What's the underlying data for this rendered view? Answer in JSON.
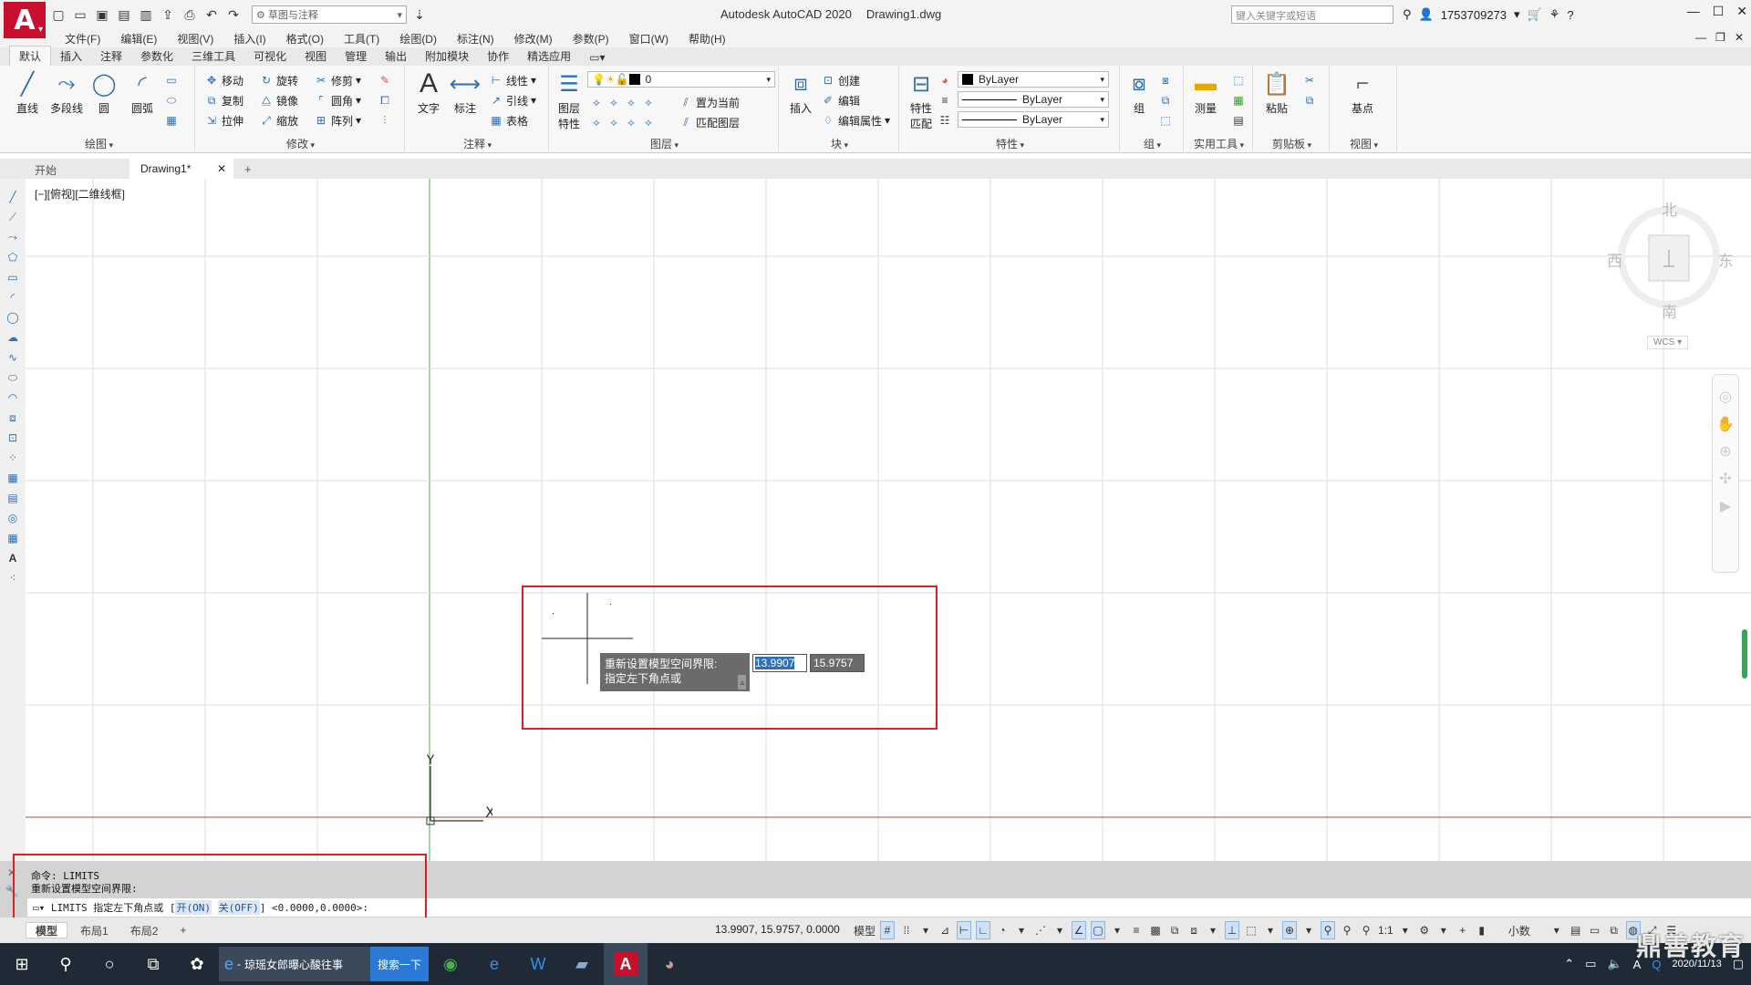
{
  "titlebar": {
    "logo": "A",
    "app_name": "Autodesk AutoCAD 2020",
    "file_name": "Drawing1.dwg",
    "workspace": "草图与注释",
    "search_placeholder": "键入关键字或短语",
    "user": "1753709273"
  },
  "menubar": [
    "文件(F)",
    "编辑(E)",
    "视图(V)",
    "插入(I)",
    "格式(O)",
    "工具(T)",
    "绘图(D)",
    "标注(N)",
    "修改(M)",
    "参数(P)",
    "窗口(W)",
    "帮助(H)"
  ],
  "ribbon_tabs": [
    "默认",
    "插入",
    "注释",
    "参数化",
    "三维工具",
    "可视化",
    "视图",
    "管理",
    "输出",
    "附加模块",
    "协作",
    "精选应用"
  ],
  "ribbon": {
    "draw": {
      "title": "绘图",
      "line": "直线",
      "polyline": "多段线",
      "circle": "圆",
      "arc": "圆弧"
    },
    "modify": {
      "title": "修改",
      "move": "移动",
      "rotate": "旋转",
      "trim": "修剪",
      "copy": "复制",
      "mirror": "镜像",
      "fillet": "圆角",
      "stretch": "拉伸",
      "scale": "缩放",
      "array": "阵列"
    },
    "annotation": {
      "title": "注释",
      "text": "文字",
      "dimension": "标注",
      "linear": "线性",
      "leader": "引线",
      "table": "表格"
    },
    "layers": {
      "title": "图层",
      "properties_line1": "图层",
      "properties_line2": "特性",
      "current_layer": "0",
      "set_current": "置为当前",
      "match_layer": "匹配图层"
    },
    "block": {
      "title": "块",
      "insert": "插入",
      "create": "创建",
      "edit": "编辑",
      "edit_attributes": "编辑属性"
    },
    "properties": {
      "title": "特性",
      "match_line1": "特性",
      "match_line2": "匹配",
      "color": "ByLayer",
      "linetype": "ByLayer",
      "lineweight": "ByLayer"
    },
    "groups": {
      "title": "组",
      "group": "组"
    },
    "utilities": {
      "title": "实用工具",
      "measure": "测量"
    },
    "clipboard": {
      "title": "剪贴板",
      "paste": "粘贴"
    },
    "view": {
      "title": "视图",
      "base": "基点"
    }
  },
  "file_tabs": {
    "start": "开始",
    "drawing": "Drawing1*"
  },
  "viewport": {
    "label": "[−][俯视][二维线框]",
    "viewcube": {
      "north": "北",
      "south": "南",
      "east": "东",
      "west": "西",
      "wcs": "WCS"
    },
    "ucs_x": "X",
    "ucs_y": "Y"
  },
  "dynamic_input": {
    "line1": "重新设置模型空间界限:",
    "line2": "指定左下角点或",
    "x_value": "13.9907",
    "y_value": "15.9757"
  },
  "command_line": {
    "history1": "命令: LIMITS",
    "history2": "重新设置模型空间界限:",
    "prompt_prefix": "LIMITS 指定左下角点或 [",
    "opt_on": "开(ON)",
    "opt_off": "关(OFF)",
    "prompt_suffix": "] <0.0000,0.0000>:"
  },
  "layout_tabs": [
    "模型",
    "布局1",
    "布局2"
  ],
  "statusbar": {
    "coords": "13.9907, 15.9757, 0.0000",
    "model": "模型",
    "scale": "1:1",
    "units": "小数"
  },
  "taskbar": {
    "ie_title": "琼瑶女郎曝心酸往事",
    "search_button": "搜索一下",
    "time": "",
    "date": "2020/11/13"
  },
  "watermark": "鼎善教育",
  "colors": {
    "accent": "#2e6fb5",
    "autocad_red": "#c8102e",
    "highlight_box": "#e02020"
  }
}
